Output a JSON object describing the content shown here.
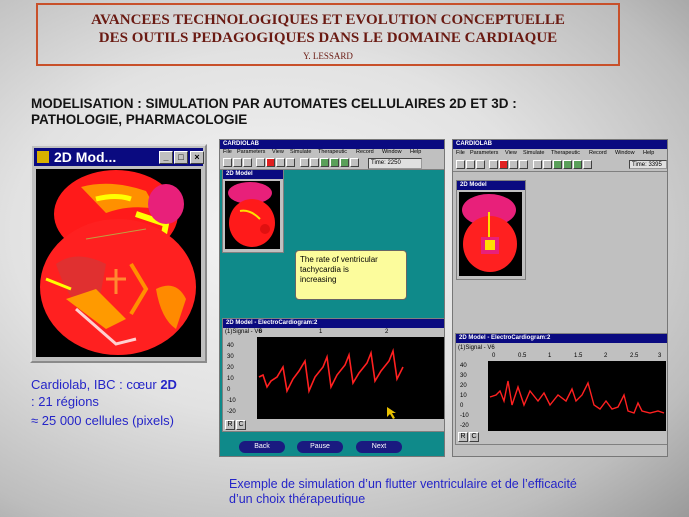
{
  "title": {
    "line1": "AVANCEES TECHNOLOGIQUES ET EVOLUTION CONCEPTUELLE",
    "line2": "DES OUTILS PEDAGOGIQUES DANS LE DOMAINE CARDIAQUE",
    "author": "Y. LESSARD"
  },
  "heading": {
    "line1": "MODELISATION : SIMULATION PAR AUTOMATES CELLULAIRES 2D ET 3D :",
    "line2": "PATHOLOGIE, PHARMACOLOGIE"
  },
  "left_window": {
    "title": "2D Mod...",
    "controls": [
      "_",
      "□",
      "×"
    ]
  },
  "left_caption": {
    "line1_prefix": "Cardiolab, IBC : cœur ",
    "line1_bold": "2D",
    "line2": ": 21 régions",
    "line3": "≈ 25 000 cellules (pixels)"
  },
  "middle_app": {
    "title": "CARDIOLAB",
    "menu": [
      "File",
      "Parameters",
      "View",
      "Simulate",
      "Therapeutic",
      "Record",
      "Window",
      "Help"
    ],
    "time": "Time: 2250",
    "model_title": "2D Model",
    "tooltip": [
      "The rate of ventricular",
      "tachycardia is",
      "increasing"
    ],
    "ecg_title": "2D Model - ElectroCardiogram:2",
    "signal_label": "(1)Signal - V6",
    "x_ticks": [
      "0",
      "1",
      "2"
    ],
    "y_ticks": [
      "40",
      "30",
      "20",
      "10",
      "0",
      "-10",
      "-20"
    ],
    "rc": [
      "R",
      "C"
    ],
    "buttons": [
      "Back",
      "Pause",
      "Next"
    ]
  },
  "right_app": {
    "title": "CARDIOLAB",
    "menu": [
      "File",
      "Parameters",
      "View",
      "Simulate",
      "Therapeutic",
      "Record",
      "Window",
      "Help"
    ],
    "time": "Time: 3395",
    "model_title": "2D Model",
    "ecg_title": "2D Model - ElectroCardiogram:2",
    "signal_label": "(1)Signal - V6",
    "x_ticks": [
      "0",
      "0.5",
      "1",
      "1.5",
      "2",
      "2.5",
      "3"
    ],
    "y_ticks": [
      "40",
      "30",
      "20",
      "10",
      "0",
      "-10",
      "-20"
    ],
    "rc": [
      "R",
      "C"
    ]
  },
  "bottom_caption": {
    "line1": "Exemple de simulation d’un flutter ventriculaire et de l’efficacité",
    "line2": "d’un choix thérapeutique"
  },
  "colors": {
    "ecg_trace": "#ff2020",
    "title_text": "#6a1a12",
    "title_border": "#c8502a",
    "caption": "#2525c8"
  }
}
